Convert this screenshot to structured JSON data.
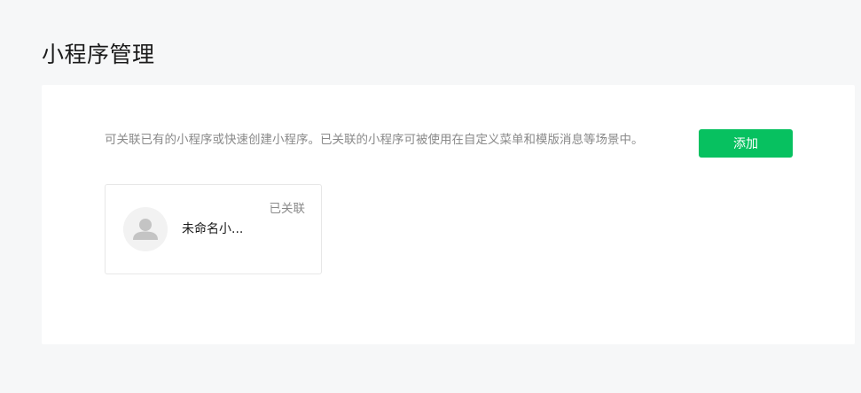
{
  "page": {
    "title": "小程序管理"
  },
  "panel": {
    "description": "可关联已有的小程序或快速创建小程序。已关联的小程序可被使用在自定义菜单和模版消息等场景中。",
    "add_button_label": "添加"
  },
  "apps": [
    {
      "name": "未命名小...",
      "status": "已关联",
      "avatar_icon": "default-user-avatar-icon"
    }
  ],
  "colors": {
    "background": "#f6f7f8",
    "panel": "#ffffff",
    "accent": "#07c160",
    "text_primary": "#1a1a1a",
    "text_secondary": "#8a8a8a",
    "card_border": "#e7e7e7"
  }
}
